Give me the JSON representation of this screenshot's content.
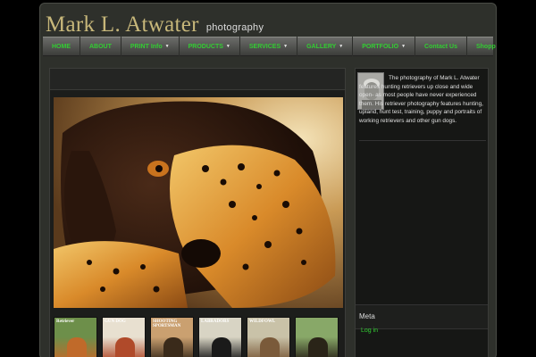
{
  "header": {
    "title": "Mark L. Atwater",
    "subtitle": "photography"
  },
  "nav": {
    "items": [
      {
        "label": "HOME",
        "dropdown": false
      },
      {
        "label": "ABOUT",
        "dropdown": false
      },
      {
        "label": "PRINT Info",
        "dropdown": true
      },
      {
        "label": "PRODUCTS",
        "dropdown": true
      },
      {
        "label": "SERVICES",
        "dropdown": true
      },
      {
        "label": "GALLERY",
        "dropdown": true
      },
      {
        "label": "PORTFOLIO",
        "dropdown": true
      },
      {
        "label": "Contact Us",
        "dropdown": false
      },
      {
        "label": "Shopping Cart",
        "dropdown": false
      }
    ],
    "dropdown_glyph": "▼"
  },
  "main": {
    "hero_subject": "dog with pheasant",
    "thumbnails": [
      {
        "title": "Retriever",
        "icon": "magazine-cover"
      },
      {
        "title": "GUN DOG",
        "icon": "magazine-cover"
      },
      {
        "title": "SHOOTING SPORTSMAN",
        "icon": "magazine-cover"
      },
      {
        "title": "LABRADORS",
        "icon": "magazine-cover"
      },
      {
        "title": "WILDFOWL",
        "icon": "magazine-cover"
      },
      {
        "title": "",
        "icon": "magazine-cover"
      }
    ]
  },
  "sidebar": {
    "about_text": "The photography of Mark L. Atwater features hunting retrievers up close and wide open- as most people have never experienced them. His retriever photography features hunting, upland, hunt test, training, puppy and portraits of working retrievers and other gun dogs.",
    "meta_title": "Meta",
    "login_label": "Log in"
  },
  "colors": {
    "accent": "#33cc33",
    "logo": "#c7b77a",
    "frame": "#2e302b"
  }
}
